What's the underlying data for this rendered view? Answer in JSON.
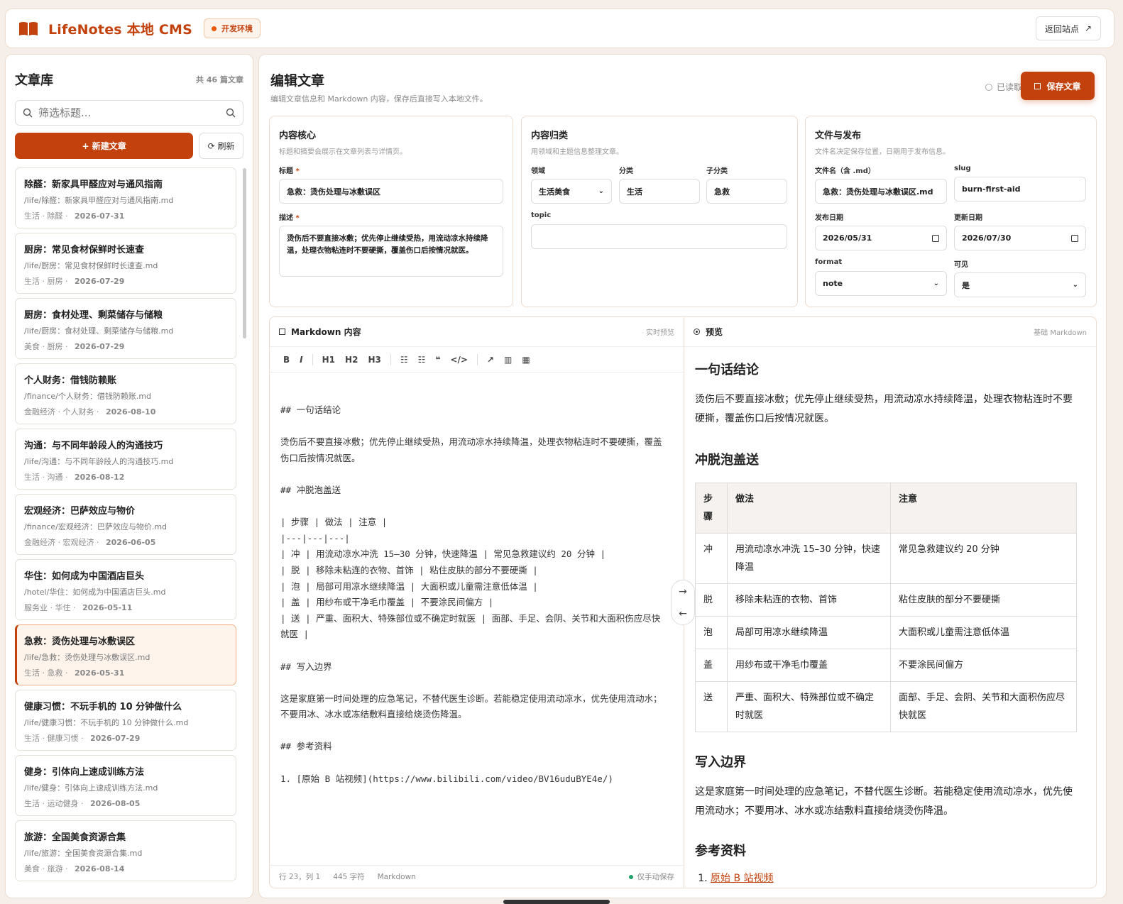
{
  "header": {
    "brand": "LifeNotes 本地 CMS",
    "env_badge": "开发环境",
    "back_label": "返回站点",
    "accent": "#c2410c"
  },
  "sidebar": {
    "title": "文章库",
    "count": "共 46 篇文章",
    "search_placeholder": "筛选标题...",
    "new_label": "+ 新建文章",
    "refresh_label": "⟳ 刷新",
    "items": [
      {
        "title": "除醛：新家具甲醛应对与通风指南",
        "path": "/life/除醛：新家具甲醛应对与通风指南.md",
        "cat": "生活 · 除醛",
        "date": "2026-07-31"
      },
      {
        "title": "厨房：常见食材保鲜时长速查",
        "path": "/life/厨房：常见食材保鲜时长速查.md",
        "cat": "生活 · 厨房",
        "date": "2026-07-29"
      },
      {
        "title": "厨房：食材处理、剩菜储存与储粮",
        "path": "/life/厨房：食材处理、剩菜储存与储粮.md",
        "cat": "美食 · 厨房",
        "date": "2026-07-29"
      },
      {
        "title": "个人财务：借钱防赖账",
        "path": "/finance/个人财务：借钱防赖账.md",
        "cat": "金融经济 · 个人财务",
        "date": "2026-08-10"
      },
      {
        "title": "沟通：与不同年龄段人的沟通技巧",
        "path": "/life/沟通：与不同年龄段人的沟通技巧.md",
        "cat": "生活 · 沟通",
        "date": "2026-08-12"
      },
      {
        "title": "宏观经济：巴萨效应与物价",
        "path": "/finance/宏观经济：巴萨效应与物价.md",
        "cat": "金融经济 · 宏观经济",
        "date": "2026-06-05"
      },
      {
        "title": "华住：如何成为中国酒店巨头",
        "path": "/hotel/华住：如何成为中国酒店巨头.md",
        "cat": "服务业 · 华住",
        "date": "2026-05-11"
      },
      {
        "title": "急救：烫伤处理与冰敷误区",
        "path": "/life/急救：烫伤处理与冰敷误区.md",
        "cat": "生活 · 急救",
        "date": "2026-05-31"
      },
      {
        "title": "健康习惯：不玩手机的 10 分钟做什么",
        "path": "/life/健康习惯：不玩手机的 10 分钟做什么.md",
        "cat": "生活 · 健康习惯",
        "date": "2026-07-29"
      },
      {
        "title": "健身：引体向上速成训练方法",
        "path": "/life/健身：引体向上速成训练方法.md",
        "cat": "生活 · 运动健身",
        "date": "2026-08-05"
      },
      {
        "title": "旅游：全国美食资源合集",
        "path": "/life/旅游：全国美食资源合集.md",
        "cat": "美食 · 旅游",
        "date": "2026-08-14"
      }
    ]
  },
  "main": {
    "title": "编辑文章",
    "subtitle": "编辑文章信息和 Markdown 内容，保存后直接写入本地文件。",
    "status": "已读取",
    "save_label": "保存文章",
    "core": {
      "title": "内容核心",
      "desc": "标题和摘要会展示在文章列表与详情页。",
      "title_label": "标题",
      "title_value": "急救：烫伤处理与冰敷误区",
      "desc_label": "描述",
      "desc_value": "烫伤后不要直接冰敷；优先停止继续受热，用流动凉水持续降温，处理衣物粘连时不要硬撕，覆盖伤口后按情况就医。"
    },
    "category": {
      "title": "内容归类",
      "desc": "用领域和主题信息整理文章。",
      "domain_label": "领域",
      "domain_value": "生活美食",
      "cat_label": "分类",
      "cat_value": "生活",
      "subcat_label": "子分类",
      "subcat_value": "急救",
      "topic_label": "topic",
      "topic_value": ""
    },
    "file": {
      "title": "文件与发布",
      "desc": "文件名决定保存位置，日期用于发布信息。",
      "filename_label": "文件名（含 .md）",
      "filename_value": "急救：烫伤处理与冰敷误区.md",
      "slug_label": "slug",
      "slug_value": "burn-first-aid",
      "pub_label": "发布日期",
      "pub_value": "2026/05/31",
      "upd_label": "更新日期",
      "upd_value": "2026/07/30",
      "format_label": "format",
      "format_value": "note",
      "visible_label": "可见",
      "visible_value": "是"
    }
  },
  "editor": {
    "title": "Markdown 内容",
    "realtime": "实时预览",
    "toolbar": [
      "B",
      "I",
      "H1",
      "H2",
      "H3",
      "☷",
      "☷",
      "❝",
      "</>",
      "↗",
      "▥",
      "▦"
    ],
    "content": "## 一句话结论\n\n烫伤后不要直接冰敷；优先停止继续受热，用流动凉水持续降温，处理衣物粘连时不要硬撕，覆盖伤口后按情况就医。\n\n## 冲脱泡盖送\n\n| 步骤 | 做法 | 注意 |\n|---|---|---|\n| 冲 | 用流动凉水冲洗 15–30 分钟，快速降温 | 常见急救建议约 20 分钟 |\n| 脱 | 移除未粘连的衣物、首饰 | 粘住皮肤的部分不要硬撕 |\n| 泡 | 局部可用凉水继续降温 | 大面积或儿童需注意低体温 |\n| 盖 | 用纱布或干净毛巾覆盖 | 不要涂民间偏方 |\n| 送 | 严重、面积大、特殊部位或不确定时就医 | 面部、手足、会阴、关节和大面积伤应尽快就医 |\n\n## 写入边界\n\n这是家庭第一时间处理的应急笔记，不替代医生诊断。若能稳定使用流动凉水，优先使用流动水；不要用冰、冰水或冻结敷料直接给烧烫伤降温。\n\n## 参考资料\n\n1. [原始 B 站视频](https://www.bilibili.com/video/BV16uduBYE4e/)",
    "foot_pos": "行 23，列 1",
    "foot_chars": "445 字符",
    "foot_mode": "Markdown",
    "foot_save": "仅手动保存"
  },
  "preview": {
    "title": "预览",
    "badge": "基础 Markdown",
    "h1": "一句话结论",
    "p1": "烫伤后不要直接冰敷；优先停止继续受热，用流动凉水持续降温，处理衣物粘连时不要硬撕，覆盖伤口后按情况就医。",
    "h2": "冲脱泡盖送",
    "table_head": [
      "步骤",
      "做法",
      "注意"
    ],
    "table_rows": [
      [
        "冲",
        "用流动凉水冲洗 15–30 分钟，快速降温",
        "常见急救建议约 20 分钟"
      ],
      [
        "脱",
        "移除未粘连的衣物、首饰",
        "粘住皮肤的部分不要硬撕"
      ],
      [
        "泡",
        "局部可用凉水继续降温",
        "大面积或儿童需注意低体温"
      ],
      [
        "盖",
        "用纱布或干净毛巾覆盖",
        "不要涂民间偏方"
      ],
      [
        "送",
        "严重、面积大、特殊部位或不确定时就医",
        "面部、手足、会阴、关节和大面积伤应尽快就医"
      ]
    ],
    "h3": "写入边界",
    "p3": "这是家庭第一时间处理的应急笔记，不替代医生诊断。若能稳定使用流动凉水，优先使用流动水；不要用冰、冰水或冻结敷料直接给烧烫伤降温。",
    "h4": "参考资料",
    "ref": "原始 B 站视频"
  }
}
